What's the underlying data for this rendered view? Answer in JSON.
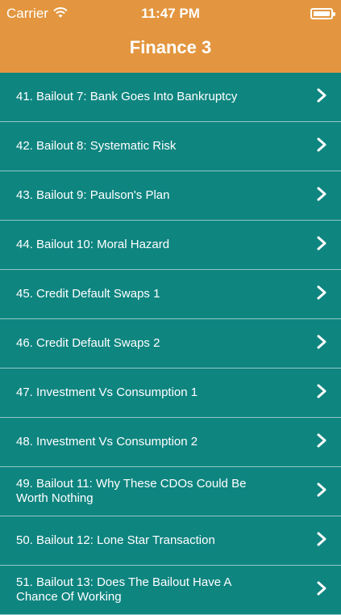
{
  "status": {
    "carrier": "Carrier",
    "time": "11:47 PM"
  },
  "nav": {
    "title": "Finance 3"
  },
  "items": [
    {
      "label": "41. Bailout 7: Bank Goes Into Bankruptcy"
    },
    {
      "label": "42. Bailout 8: Systematic Risk"
    },
    {
      "label": "43. Bailout 9: Paulson's Plan"
    },
    {
      "label": "44. Bailout 10: Moral Hazard"
    },
    {
      "label": "45. Credit Default Swaps 1"
    },
    {
      "label": "46. Credit Default Swaps 2"
    },
    {
      "label": "47. Investment Vs Consumption 1"
    },
    {
      "label": "48. Investment Vs Consumption 2"
    },
    {
      "label": "49. Bailout 11: Why These CDOs Could Be Worth Nothing"
    },
    {
      "label": "50. Bailout 12: Lone Star Transaction"
    },
    {
      "label": "51. Bailout 13: Does The Bailout Have A Chance Of Working"
    }
  ]
}
